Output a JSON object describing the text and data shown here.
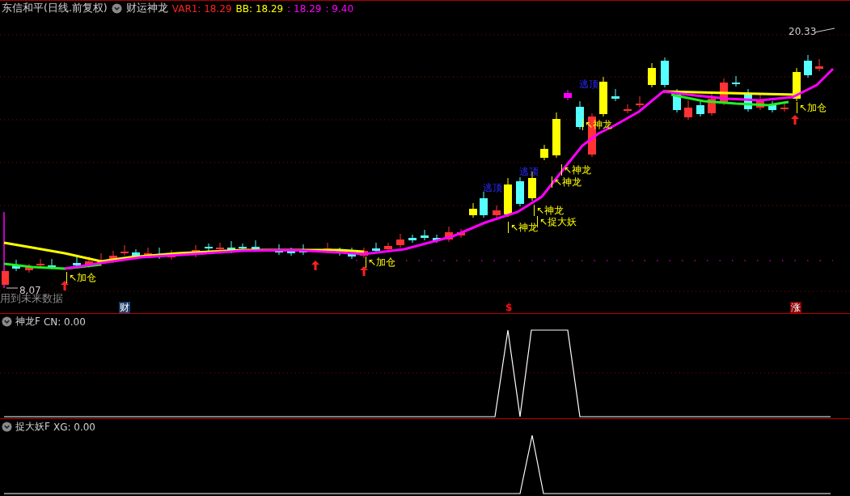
{
  "header": {
    "title": "东信和平(日线.前复权)",
    "indicator": "财运神龙",
    "readings": [
      {
        "text": "VAR1: 18.29",
        "color": "#ff2020"
      },
      {
        "text": "BB: 18.29",
        "color": "#ffff00"
      },
      {
        "text": ": 18.29",
        "color": "#ff00ff"
      },
      {
        "text": ": 9.40",
        "color": "#ff00ff"
      }
    ]
  },
  "price_chart": {
    "high_label": "20.33",
    "low_label": "8.07",
    "warning": "用到未来数据",
    "signals": [
      {
        "kind": "top",
        "text": "逃顶"
      },
      {
        "kind": "buy",
        "text": "↖加仓"
      },
      {
        "kind": "buy",
        "text": "↖神龙"
      },
      {
        "kind": "buy",
        "text": "↖神龙"
      },
      {
        "kind": "top",
        "text": "逃顶"
      },
      {
        "kind": "buy",
        "text": "↖神龙"
      },
      {
        "kind": "top",
        "text": "逃顶"
      },
      {
        "kind": "buy",
        "text": "↖神龙"
      },
      {
        "kind": "buy",
        "text": "↖捉大妖"
      },
      {
        "kind": "buy",
        "text": "↖神龙"
      },
      {
        "kind": "buy",
        "text": "↖加仓"
      },
      {
        "kind": "buy",
        "text": "↖加仓"
      }
    ],
    "markers": [
      {
        "kind": "boxed",
        "text": "财",
        "color": "#1c3f6e"
      },
      {
        "kind": "plain",
        "text": "$",
        "color": "#ff1010"
      },
      {
        "kind": "boxed",
        "text": "涨",
        "color": "#8a0000"
      }
    ]
  },
  "panels": [
    {
      "name": "神龙F",
      "reading": "CN: 0.00"
    },
    {
      "name": "捉大妖F",
      "reading": "XG: 0.00"
    }
  ]
}
